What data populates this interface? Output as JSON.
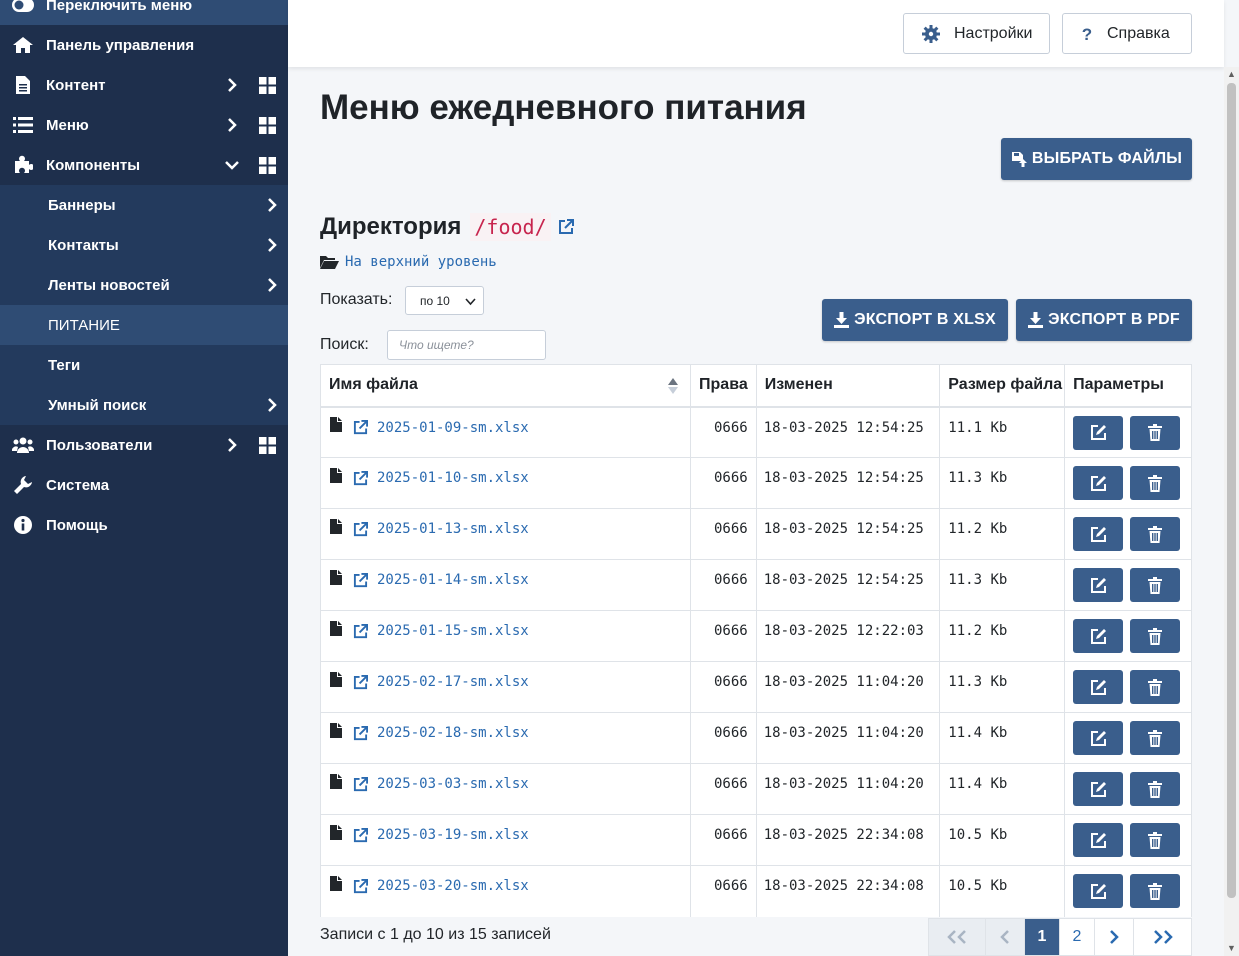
{
  "sidebar": {
    "toggle_label": "Переключить меню",
    "items": [
      {
        "label": "Панель управления",
        "icon": "home-icon"
      },
      {
        "label": "Контент",
        "icon": "file-icon"
      },
      {
        "label": "Меню",
        "icon": "list-icon"
      },
      {
        "label": "Компоненты",
        "icon": "puzzle-icon"
      },
      {
        "label": "Баннеры"
      },
      {
        "label": "Контакты"
      },
      {
        "label": "Ленты новостей"
      },
      {
        "label": "ПИТАНИЕ"
      },
      {
        "label": "Теги"
      },
      {
        "label": "Умный поиск"
      },
      {
        "label": "Пользователи",
        "icon": "users-icon"
      },
      {
        "label": "Система",
        "icon": "wrench-icon"
      },
      {
        "label": "Помощь",
        "icon": "info-icon"
      }
    ]
  },
  "header": {
    "settings_label": "Настройки",
    "help_label": "Справка"
  },
  "page": {
    "title": "Меню ежедневного питания",
    "choose_files_label": "ВЫБРАТЬ ФАЙЛЫ",
    "directory_label": "Директория",
    "directory_path": "/food/",
    "up_level_label": "На верхний уровень",
    "show_label": "Показать:",
    "show_value": "по 10",
    "search_label": "Поиск:",
    "search_placeholder": "Что ищете?",
    "export_xlsx_label": "ЭКСПОРТ В XLSX",
    "export_pdf_label": "ЭКСПОРТ В PDF"
  },
  "table": {
    "headers": [
      "Имя файла",
      "Права",
      "Изменен",
      "Размер файла",
      "Параметры"
    ],
    "rows": [
      {
        "name": "2025-01-09-sm.xlsx",
        "perm": "0666",
        "modified": "18-03-2025 12:54:25",
        "size": "11.1 Kb"
      },
      {
        "name": "2025-01-10-sm.xlsx",
        "perm": "0666",
        "modified": "18-03-2025 12:54:25",
        "size": "11.3 Kb"
      },
      {
        "name": "2025-01-13-sm.xlsx",
        "perm": "0666",
        "modified": "18-03-2025 12:54:25",
        "size": "11.2 Kb"
      },
      {
        "name": "2025-01-14-sm.xlsx",
        "perm": "0666",
        "modified": "18-03-2025 12:54:25",
        "size": "11.3 Kb"
      },
      {
        "name": "2025-01-15-sm.xlsx",
        "perm": "0666",
        "modified": "18-03-2025 12:22:03",
        "size": "11.2 Kb"
      },
      {
        "name": "2025-02-17-sm.xlsx",
        "perm": "0666",
        "modified": "18-03-2025 11:04:20",
        "size": "11.3 Kb"
      },
      {
        "name": "2025-02-18-sm.xlsx",
        "perm": "0666",
        "modified": "18-03-2025 11:04:20",
        "size": "11.4 Kb"
      },
      {
        "name": "2025-03-03-sm.xlsx",
        "perm": "0666",
        "modified": "18-03-2025 11:04:20",
        "size": "11.4 Kb"
      },
      {
        "name": "2025-03-19-sm.xlsx",
        "perm": "0666",
        "modified": "18-03-2025 22:34:08",
        "size": "10.5 Kb"
      },
      {
        "name": "2025-03-20-sm.xlsx",
        "perm": "0666",
        "modified": "18-03-2025 22:34:08",
        "size": "10.5 Kb"
      }
    ]
  },
  "footer": {
    "info": "Записи с 1 до 10 из 15 записей",
    "pages": [
      "1",
      "2"
    ],
    "current_page": "1"
  },
  "colors": {
    "sidebar_bg": "#1e2f4c",
    "accent": "#3a5e8c",
    "link": "#2a6ab0",
    "path_red": "#c7254e"
  }
}
